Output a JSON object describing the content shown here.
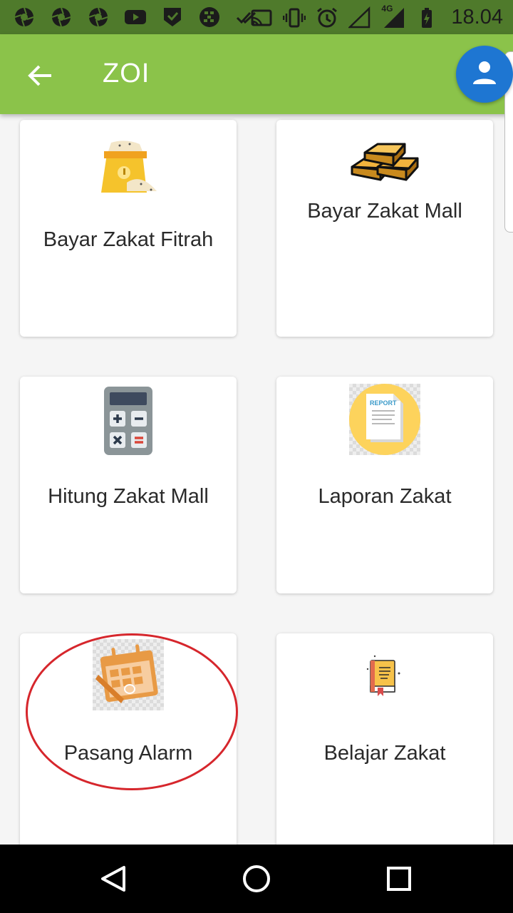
{
  "status_bar": {
    "time": "18.04",
    "network_label": "4G",
    "icons": [
      "aperture-icon",
      "aperture-icon",
      "aperture-icon",
      "youtube-icon",
      "shield-check-icon",
      "bbm-icon",
      "double-check-icon",
      "cast-icon",
      "vibrate-icon",
      "alarm-icon",
      "signal-icon",
      "signal-4g-icon",
      "battery-charging-icon"
    ]
  },
  "app_bar": {
    "title": "ZOI",
    "back_icon": "arrow-back-icon",
    "avatar_icon": "person-icon",
    "color": "#8bc34a"
  },
  "menu": {
    "items": [
      {
        "label": "Bayar Zakat Fitrah",
        "icon": "rice-sack-icon"
      },
      {
        "label": "Bayar Zakat Mall",
        "icon": "gold-bars-icon"
      },
      {
        "label": "Hitung Zakat Mall",
        "icon": "calculator-icon"
      },
      {
        "label": "Laporan Zakat",
        "icon": "report-icon",
        "icon_text": "REPORT"
      },
      {
        "label": "Pasang Alarm",
        "icon": "calendar-icon"
      },
      {
        "label": "Belajar Zakat",
        "icon": "book-icon"
      }
    ]
  },
  "annotation": {
    "color": "#d6262c",
    "target": "Pasang Alarm"
  },
  "nav_bar": {
    "buttons": [
      "back-triangle-icon",
      "home-circle-icon",
      "recents-square-icon"
    ]
  }
}
